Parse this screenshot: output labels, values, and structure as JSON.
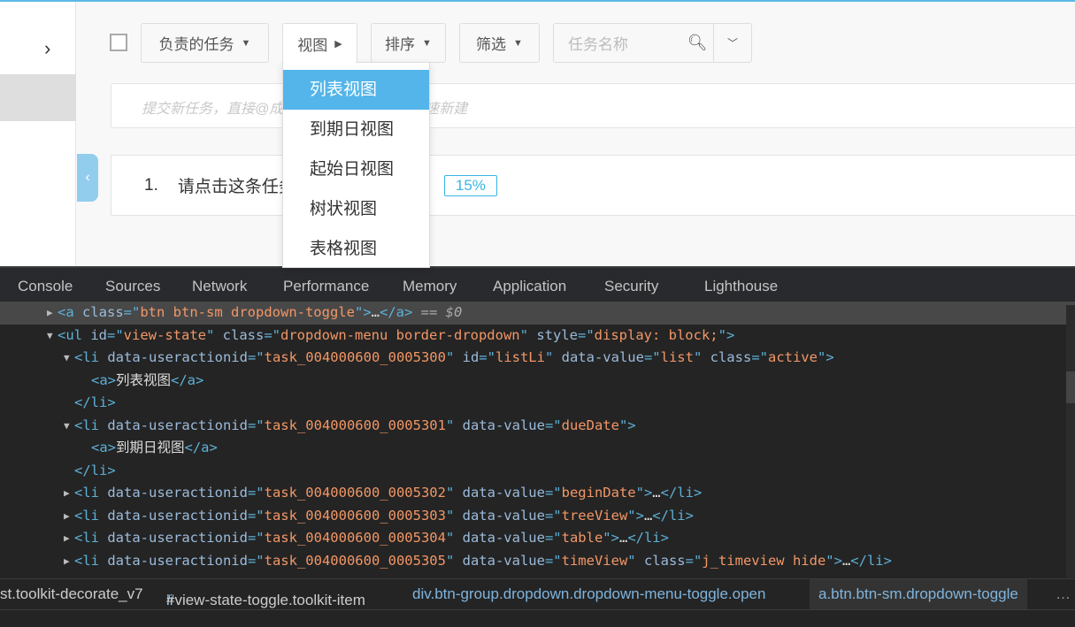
{
  "toolbar": {
    "my_tasks": "负责的任务",
    "view": "视图",
    "sort": "排序",
    "filter": "筛选",
    "search_placeholder": "任务名称"
  },
  "new_task_placeholder": "提交新任务，直接@成员并设置截止时间，快速新建",
  "task": {
    "index": "1.",
    "title": "请点击这条任务，查看任务的详情",
    "progress": "15%",
    "progress_value": 15
  },
  "view_menu": {
    "items": [
      {
        "label": "列表视图",
        "active": true
      },
      {
        "label": "到期日视图"
      },
      {
        "label": "起始日视图"
      },
      {
        "label": "树状视图"
      },
      {
        "label": "表格视图"
      }
    ]
  },
  "devtools": {
    "tabs": [
      "Console",
      "Sources",
      "Network",
      "Performance",
      "Memory",
      "Application",
      "Security",
      "Lighthouse"
    ],
    "lines": [
      {
        "indent": 65,
        "tri": "▶",
        "sel": true,
        "seg": [
          [
            "tag",
            "<a "
          ],
          [
            "an",
            "class"
          ],
          [
            "tag",
            "=\""
          ],
          [
            "av",
            "btn btn-sm dropdown-toggle"
          ],
          [
            "tag",
            "\">"
          ],
          [
            "tx",
            "…"
          ],
          [
            "tag",
            "</a>"
          ],
          [
            "eq",
            " == $0"
          ]
        ]
      },
      {
        "indent": 65,
        "tri": "▼",
        "seg": [
          [
            "tag",
            "<ul "
          ],
          [
            "an",
            "id"
          ],
          [
            "tag",
            "=\""
          ],
          [
            "av",
            "view-state"
          ],
          [
            "tag",
            "\" "
          ],
          [
            "an",
            "class"
          ],
          [
            "tag",
            "=\""
          ],
          [
            "av",
            "dropdown-menu border-dropdown"
          ],
          [
            "tag",
            "\" "
          ],
          [
            "an",
            "style"
          ],
          [
            "tag",
            "=\""
          ],
          [
            "av",
            "display: block;"
          ],
          [
            "tag",
            "\">"
          ]
        ]
      },
      {
        "indent": 84,
        "tri": "▼",
        "seg": [
          [
            "tag",
            "<li "
          ],
          [
            "an",
            "data-useractionid"
          ],
          [
            "tag",
            "=\""
          ],
          [
            "av",
            "task_004000600_0005300"
          ],
          [
            "tag",
            "\" "
          ],
          [
            "an",
            "id"
          ],
          [
            "tag",
            "=\""
          ],
          [
            "av",
            "listLi"
          ],
          [
            "tag",
            "\" "
          ],
          [
            "an",
            "data-value"
          ],
          [
            "tag",
            "=\""
          ],
          [
            "av",
            "list"
          ],
          [
            "tag",
            "\" "
          ],
          [
            "an",
            "class"
          ],
          [
            "tag",
            "=\""
          ],
          [
            "av",
            "active"
          ],
          [
            "tag",
            "\">"
          ]
        ]
      },
      {
        "indent": 103,
        "seg": [
          [
            "tag",
            "<a>"
          ],
          [
            "tx",
            "列表视图"
          ],
          [
            "tag",
            "</a>"
          ]
        ]
      },
      {
        "indent": 84,
        "seg": [
          [
            "tag",
            "</li>"
          ]
        ]
      },
      {
        "indent": 84,
        "tri": "▼",
        "seg": [
          [
            "tag",
            "<li "
          ],
          [
            "an",
            "data-useractionid"
          ],
          [
            "tag",
            "=\""
          ],
          [
            "av",
            "task_004000600_0005301"
          ],
          [
            "tag",
            "\" "
          ],
          [
            "an",
            "data-value"
          ],
          [
            "tag",
            "=\""
          ],
          [
            "av",
            "dueDate"
          ],
          [
            "tag",
            "\">"
          ]
        ]
      },
      {
        "indent": 103,
        "seg": [
          [
            "tag",
            "<a>"
          ],
          [
            "tx",
            "到期日视图"
          ],
          [
            "tag",
            "</a>"
          ]
        ]
      },
      {
        "indent": 84,
        "seg": [
          [
            "tag",
            "</li>"
          ]
        ]
      },
      {
        "indent": 84,
        "tri": "▶",
        "seg": [
          [
            "tag",
            "<li "
          ],
          [
            "an",
            "data-useractionid"
          ],
          [
            "tag",
            "=\""
          ],
          [
            "av",
            "task_004000600_0005302"
          ],
          [
            "tag",
            "\" "
          ],
          [
            "an",
            "data-value"
          ],
          [
            "tag",
            "=\""
          ],
          [
            "av",
            "beginDate"
          ],
          [
            "tag",
            "\">"
          ],
          [
            "tx",
            "…"
          ],
          [
            "tag",
            "</li>"
          ]
        ]
      },
      {
        "indent": 84,
        "tri": "▶",
        "seg": [
          [
            "tag",
            "<li "
          ],
          [
            "an",
            "data-useractionid"
          ],
          [
            "tag",
            "=\""
          ],
          [
            "av",
            "task_004000600_0005303"
          ],
          [
            "tag",
            "\" "
          ],
          [
            "an",
            "data-value"
          ],
          [
            "tag",
            "=\""
          ],
          [
            "av",
            "treeView"
          ],
          [
            "tag",
            "\">"
          ],
          [
            "tx",
            "…"
          ],
          [
            "tag",
            "</li>"
          ]
        ]
      },
      {
        "indent": 84,
        "tri": "▶",
        "seg": [
          [
            "tag",
            "<li "
          ],
          [
            "an",
            "data-useractionid"
          ],
          [
            "tag",
            "=\""
          ],
          [
            "av",
            "task_004000600_0005304"
          ],
          [
            "tag",
            "\" "
          ],
          [
            "an",
            "data-value"
          ],
          [
            "tag",
            "=\""
          ],
          [
            "av",
            "table"
          ],
          [
            "tag",
            "\">"
          ],
          [
            "tx",
            "…"
          ],
          [
            "tag",
            "</li>"
          ]
        ]
      },
      {
        "indent": 84,
        "tri": "▶",
        "seg": [
          [
            "tag",
            "<li "
          ],
          [
            "an",
            "data-useractionid"
          ],
          [
            "tag",
            "=\""
          ],
          [
            "av",
            "task_004000600_0005305"
          ],
          [
            "tag",
            "\" "
          ],
          [
            "an",
            "data-value"
          ],
          [
            "tag",
            "=\""
          ],
          [
            "av",
            "timeView"
          ],
          [
            "tag",
            "\" "
          ],
          [
            "an",
            "class"
          ],
          [
            "tag",
            "=\""
          ],
          [
            "av",
            "j_timeview hide"
          ],
          [
            "tag",
            "\">"
          ],
          [
            "tx",
            "…"
          ],
          [
            "tag",
            "</li>"
          ]
        ]
      }
    ],
    "breadcrumbs": [
      "st.toolkit-decorate_v7",
      "li#view-state-toggle.toolkit-item",
      "div.btn-group.dropdown.dropdown-menu-toggle.open",
      "a.btn.btn-sm.dropdown-toggle"
    ],
    "more": "…"
  }
}
